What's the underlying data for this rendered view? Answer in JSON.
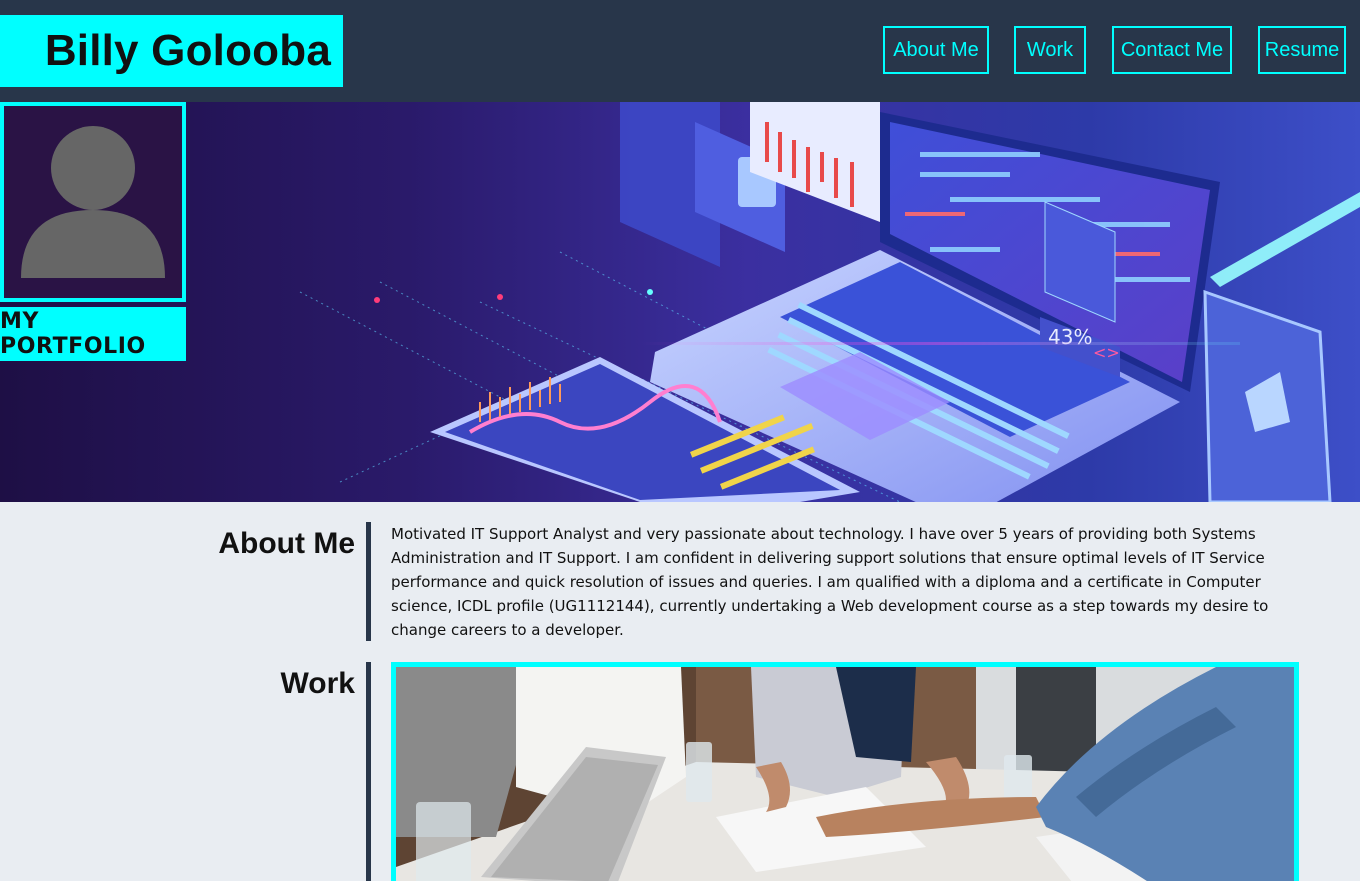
{
  "header": {
    "brand": "Billy Golooba",
    "nav": [
      {
        "label": "About Me"
      },
      {
        "label": "Work"
      },
      {
        "label": "Contact Me"
      },
      {
        "label": "Resume"
      }
    ]
  },
  "hero": {
    "stat_text": "43%",
    "stat_symbol": "<>"
  },
  "profile": {
    "avatar_icon": "user-silhouette-icon",
    "portfolio_label": "MY PORTFOLIO"
  },
  "about": {
    "title": "About Me",
    "text": "Motivated IT Support Analyst and very passionate about technology. I have over 5 years of providing both Systems Administration and IT Support. I am confident in delivering support solutions that ensure optimal levels of IT Service performance and quick resolution of issues and queries. I am qualified with a diploma and a certificate in Computer science, ICDL profile (UG1112144), currently undertaking a Web development course as a step towards my desire to change careers to a developer."
  },
  "work": {
    "title": "Work"
  },
  "colors": {
    "accent": "#00ffff",
    "header_bg": "#28364a",
    "page_bg": "#e9edf2"
  }
}
